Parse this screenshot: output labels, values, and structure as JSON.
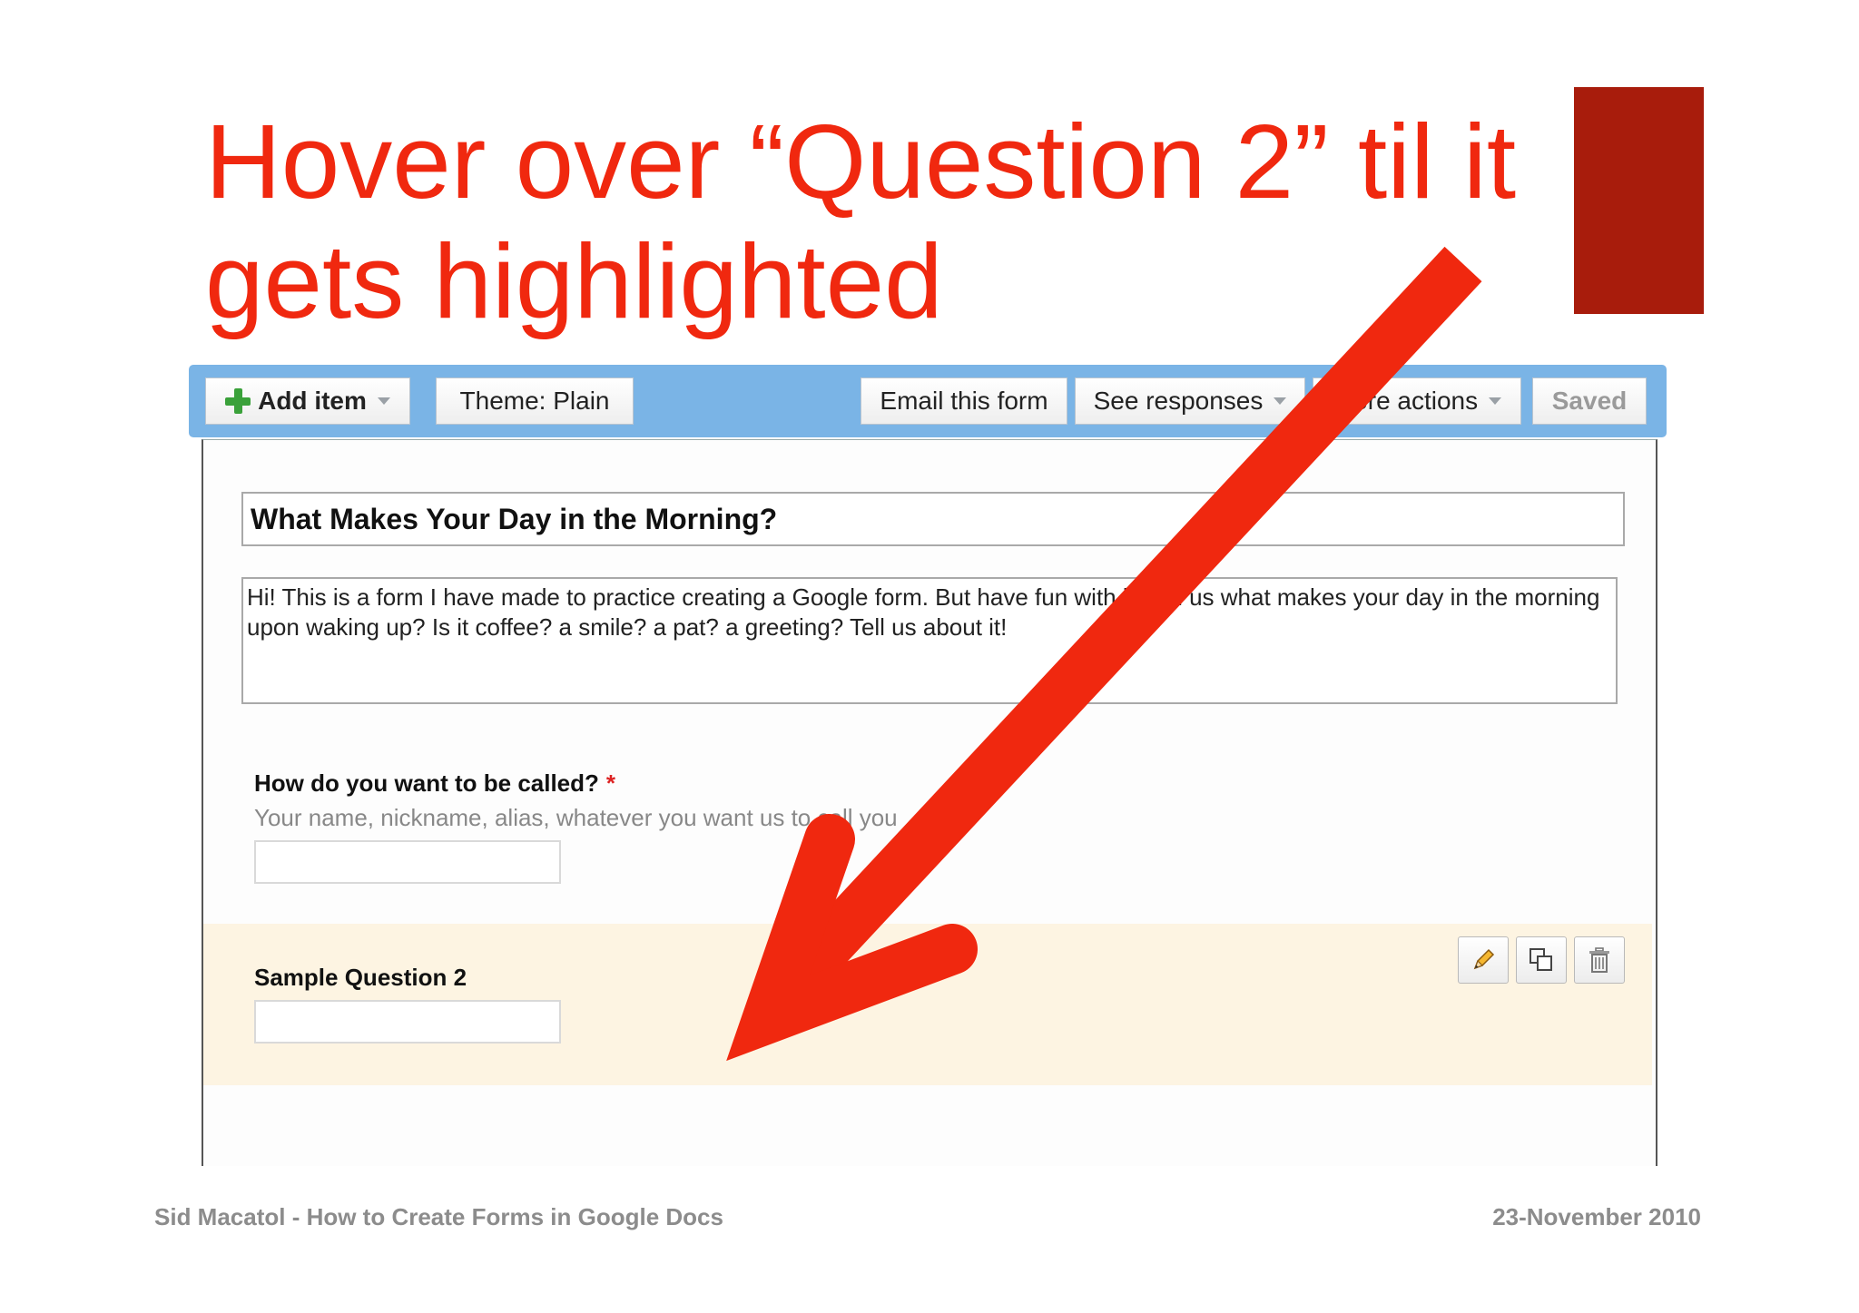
{
  "slide": {
    "title_line1": "Hover over “Question 2” til it",
    "title_line2": "gets highlighted",
    "title_color": "#f0280f",
    "accent_color": "#a81c0c"
  },
  "toolbar": {
    "add_item": "Add item",
    "theme": "Theme:  Plain",
    "email_form": "Email this form",
    "see_responses": "See responses",
    "more_actions": "More actions",
    "saved": "Saved",
    "bar_color": "#7ab4e6"
  },
  "form": {
    "title": "What Makes Your Day in the Morning?",
    "description": "Hi! This is a form I have made to practice creating a Google form. But have fun with it! Tell us what makes your day in the morning upon waking up? Is it coffee? a smile? a pat? a greeting? Tell us about it!",
    "questions": [
      {
        "label": "How do you want to be called?",
        "required_mark": "*",
        "help": "Your name, nickname, alias, whatever you want us to call you"
      },
      {
        "label": "Sample Question 2",
        "highlight_color": "#fdf4e2"
      }
    ],
    "actions": [
      {
        "icon": "pencil-icon"
      },
      {
        "icon": "duplicate-icon"
      },
      {
        "icon": "trash-icon"
      }
    ]
  },
  "footer": {
    "left": "Sid Macatol - How to Create Forms in Google Docs",
    "right": "23-November 2010"
  },
  "annotation": {
    "icon": "red-arrow-icon",
    "color": "#f0280f"
  }
}
